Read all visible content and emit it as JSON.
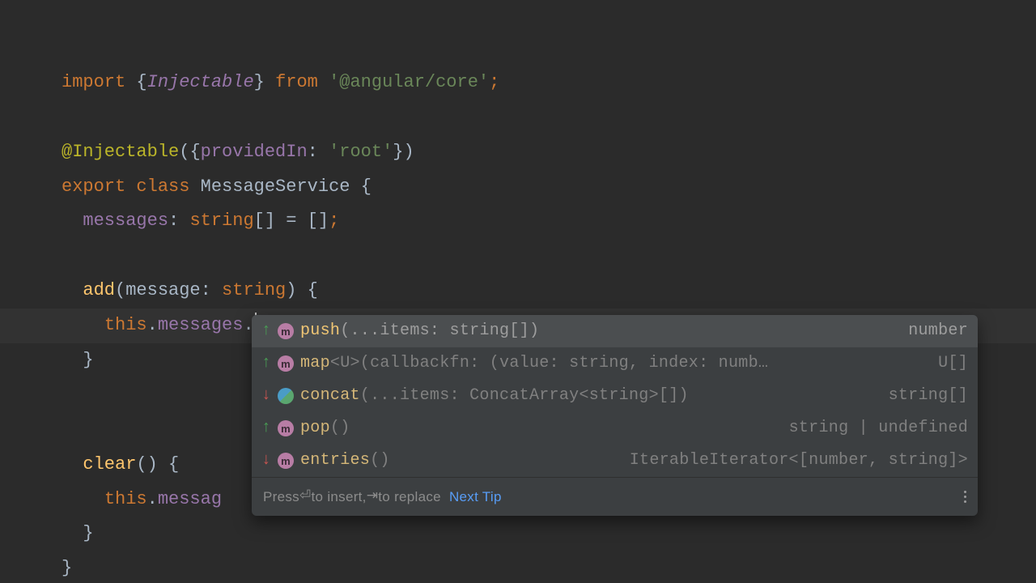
{
  "code": {
    "l1": {
      "import": "import",
      "lbrace": "{",
      "injectable": "Injectable",
      "rbrace": "}",
      "from": "from",
      "module": "'@angular/core'",
      "semi": ";"
    },
    "l3": {
      "at": "@",
      "injectable": "Injectable",
      "lp": "(",
      "lbrace": "{",
      "prop": "providedIn",
      "colon": ":",
      "val": "'root'",
      "rbrace": "}",
      "rp": ")"
    },
    "l4": {
      "export": "export",
      "class": "class",
      "name": "MessageService",
      "lbrace": "{"
    },
    "l5": {
      "prop": "messages",
      "colon": ":",
      "type": "string",
      "brackets": "[]",
      "eq": "=",
      "arr": "[]",
      "semi": ";"
    },
    "l7": {
      "fn": "add",
      "lp": "(",
      "param": "message",
      "colon": ":",
      "type": "string",
      "rp": ")",
      "lbrace": "{"
    },
    "l8": {
      "this": "this",
      "dot1": ".",
      "member": "messages",
      "dot2": "."
    },
    "l9": {
      "rbrace": "}"
    },
    "l11": {
      "fn": "clear",
      "parens": "()",
      "lbrace": "{"
    },
    "l12": {
      "this": "this",
      "dot": ".",
      "member_partial": "messag"
    },
    "l13": {
      "rbrace": "}"
    },
    "l14": {
      "rbrace": "}"
    }
  },
  "popup": {
    "items": [
      {
        "dir": "up",
        "kind": "m",
        "name": "push",
        "sig": "(...items: string[])",
        "ret": "number"
      },
      {
        "dir": "up",
        "kind": "m",
        "name": "map",
        "sig": "<U>(callbackfn: (value: string, index: numb…",
        "ret": "U[]"
      },
      {
        "dir": "down",
        "kind": "c",
        "name": "concat",
        "sig": "(...items: ConcatArray<string>[])",
        "ret": "string[]"
      },
      {
        "dir": "up",
        "kind": "m",
        "name": "pop",
        "sig": "()",
        "ret": "string | undefined"
      },
      {
        "dir": "down",
        "kind": "m",
        "name": "entries",
        "sig": "()",
        "ret": "IterableIterator<[number, string]>"
      }
    ],
    "footer": {
      "prefix": "Press ",
      "enter_glyph": "⏎",
      "insert": " to insert, ",
      "tab_glyph": "⇥",
      "replace": " to replace",
      "link": "Next Tip"
    }
  }
}
